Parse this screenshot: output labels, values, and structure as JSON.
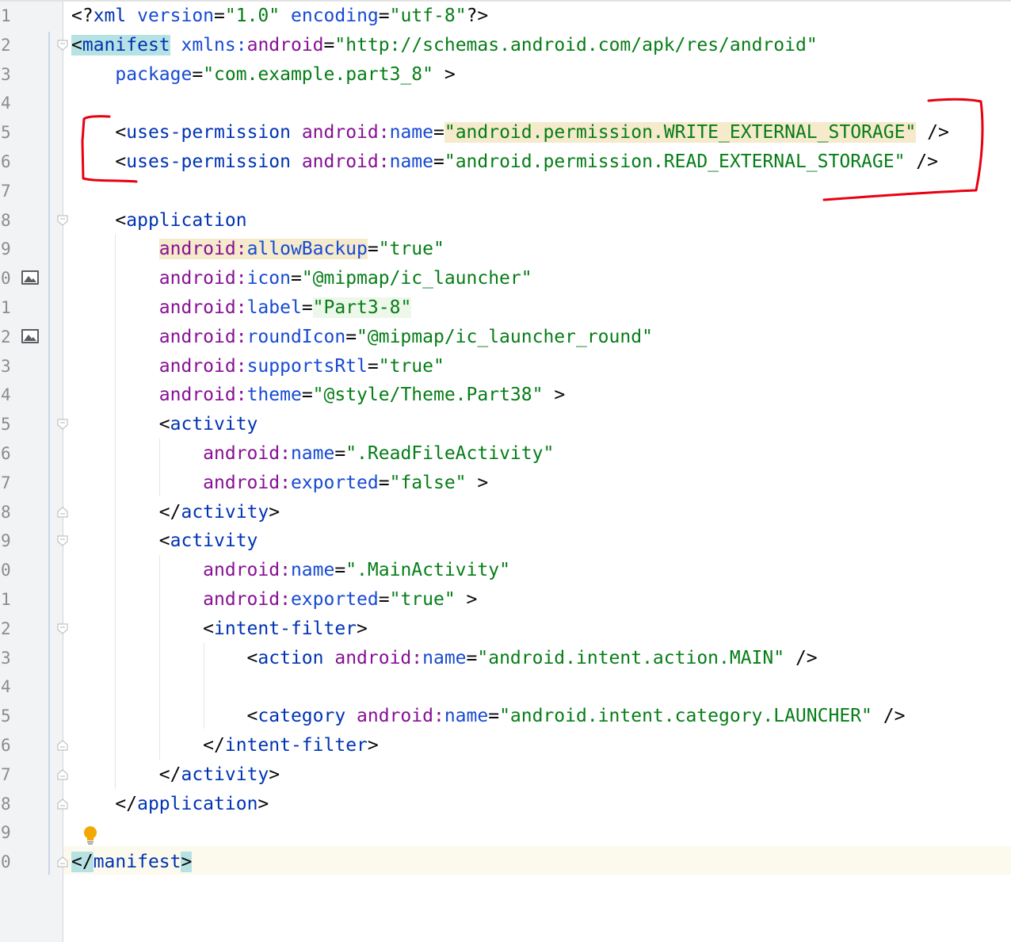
{
  "editor": {
    "line_numbers": [
      "1",
      "2",
      "3",
      "4",
      "5",
      "6",
      "7",
      "8",
      "9",
      "0",
      "1",
      "2",
      "3",
      "4",
      "5",
      "6",
      "7",
      "8",
      "9",
      "0",
      "1",
      "2",
      "3",
      "4",
      "5",
      "6",
      "7",
      "8",
      "9",
      "0"
    ],
    "lines": [
      {
        "segments": [
          {
            "t": "<?",
            "c": "punct"
          },
          {
            "t": "xml ",
            "c": "tag"
          },
          {
            "t": "version",
            "c": "attr"
          },
          {
            "t": "=",
            "c": "punct"
          },
          {
            "t": "\"1.0\"",
            "c": "val"
          },
          {
            "t": " ",
            "c": "punct"
          },
          {
            "t": "encoding",
            "c": "attr"
          },
          {
            "t": "=",
            "c": "punct"
          },
          {
            "t": "\"utf-8\"",
            "c": "val"
          },
          {
            "t": "?>",
            "c": "punct"
          }
        ]
      },
      {
        "segments": [
          {
            "t": "<",
            "c": "punct hl-teal"
          },
          {
            "t": "manifest",
            "c": "tag hl-teal"
          },
          {
            "t": " ",
            "c": "punct"
          },
          {
            "t": "xmlns:",
            "c": "attr"
          },
          {
            "t": "android",
            "c": "attr-ns"
          },
          {
            "t": "=",
            "c": "punct"
          },
          {
            "t": "\"http://schemas.android.com/apk/res/android\"",
            "c": "val"
          }
        ]
      },
      {
        "segments": [
          {
            "t": "    ",
            "c": "punct"
          },
          {
            "t": "package",
            "c": "attr"
          },
          {
            "t": "=",
            "c": "punct"
          },
          {
            "t": "\"com.example.part3_8\"",
            "c": "val"
          },
          {
            "t": " >",
            "c": "punct"
          }
        ]
      },
      {
        "segments": []
      },
      {
        "segments": [
          {
            "t": "    <",
            "c": "punct"
          },
          {
            "t": "uses-permission ",
            "c": "tag"
          },
          {
            "t": "android:",
            "c": "attr-ns"
          },
          {
            "t": "name",
            "c": "attr"
          },
          {
            "t": "=",
            "c": "punct"
          },
          {
            "t": "\"android.permission.WRITE_EXTERNAL_STORAGE\"",
            "c": "val hl-yellow"
          },
          {
            "t": " />",
            "c": "punct"
          }
        ]
      },
      {
        "segments": [
          {
            "t": "    <",
            "c": "punct"
          },
          {
            "t": "uses-permission ",
            "c": "tag"
          },
          {
            "t": "android:",
            "c": "attr-ns"
          },
          {
            "t": "name",
            "c": "attr"
          },
          {
            "t": "=",
            "c": "punct"
          },
          {
            "t": "\"android.permission.READ_EXTERNAL_STORAGE\"",
            "c": "val"
          },
          {
            "t": " />",
            "c": "punct"
          }
        ]
      },
      {
        "segments": []
      },
      {
        "segments": [
          {
            "t": "    <",
            "c": "punct"
          },
          {
            "t": "application",
            "c": "tag"
          }
        ]
      },
      {
        "segments": [
          {
            "t": "        ",
            "c": "punct"
          },
          {
            "t": "android:",
            "c": "attr-ns hl-yellow"
          },
          {
            "t": "allowBackup",
            "c": "attr hl-yellow"
          },
          {
            "t": "=",
            "c": "punct"
          },
          {
            "t": "\"true\"",
            "c": "val"
          }
        ]
      },
      {
        "segments": [
          {
            "t": "        ",
            "c": "punct"
          },
          {
            "t": "android:",
            "c": "attr-ns"
          },
          {
            "t": "icon",
            "c": "attr"
          },
          {
            "t": "=",
            "c": "punct"
          },
          {
            "t": "\"@mipmap/ic_launcher\"",
            "c": "val"
          }
        ]
      },
      {
        "segments": [
          {
            "t": "        ",
            "c": "punct"
          },
          {
            "t": "android:",
            "c": "attr-ns"
          },
          {
            "t": "label",
            "c": "attr"
          },
          {
            "t": "=",
            "c": "punct"
          },
          {
            "t": "\"Part3-8\"",
            "c": "val hl-green"
          }
        ]
      },
      {
        "segments": [
          {
            "t": "        ",
            "c": "punct"
          },
          {
            "t": "android:",
            "c": "attr-ns"
          },
          {
            "t": "roundIcon",
            "c": "attr"
          },
          {
            "t": "=",
            "c": "punct"
          },
          {
            "t": "\"@mipmap/ic_launcher_round\"",
            "c": "val"
          }
        ]
      },
      {
        "segments": [
          {
            "t": "        ",
            "c": "punct"
          },
          {
            "t": "android:",
            "c": "attr-ns"
          },
          {
            "t": "supportsRtl",
            "c": "attr"
          },
          {
            "t": "=",
            "c": "punct"
          },
          {
            "t": "\"true\"",
            "c": "val"
          }
        ]
      },
      {
        "segments": [
          {
            "t": "        ",
            "c": "punct"
          },
          {
            "t": "android:",
            "c": "attr-ns"
          },
          {
            "t": "theme",
            "c": "attr"
          },
          {
            "t": "=",
            "c": "punct"
          },
          {
            "t": "\"@style/Theme.Part38\"",
            "c": "val"
          },
          {
            "t": " >",
            "c": "punct"
          }
        ]
      },
      {
        "segments": [
          {
            "t": "        <",
            "c": "punct"
          },
          {
            "t": "activity",
            "c": "tag"
          }
        ]
      },
      {
        "segments": [
          {
            "t": "            ",
            "c": "punct"
          },
          {
            "t": "android:",
            "c": "attr-ns"
          },
          {
            "t": "name",
            "c": "attr"
          },
          {
            "t": "=",
            "c": "punct"
          },
          {
            "t": "\".ReadFileActivity\"",
            "c": "val"
          }
        ]
      },
      {
        "segments": [
          {
            "t": "            ",
            "c": "punct"
          },
          {
            "t": "android:",
            "c": "attr-ns"
          },
          {
            "t": "exported",
            "c": "attr"
          },
          {
            "t": "=",
            "c": "punct"
          },
          {
            "t": "\"false\"",
            "c": "val"
          },
          {
            "t": " >",
            "c": "punct"
          }
        ]
      },
      {
        "segments": [
          {
            "t": "        </",
            "c": "punct"
          },
          {
            "t": "activity",
            "c": "tag"
          },
          {
            "t": ">",
            "c": "punct"
          }
        ]
      },
      {
        "segments": [
          {
            "t": "        <",
            "c": "punct"
          },
          {
            "t": "activity",
            "c": "tag"
          }
        ]
      },
      {
        "segments": [
          {
            "t": "            ",
            "c": "punct"
          },
          {
            "t": "android:",
            "c": "attr-ns"
          },
          {
            "t": "name",
            "c": "attr"
          },
          {
            "t": "=",
            "c": "punct"
          },
          {
            "t": "\".MainActivity\"",
            "c": "val"
          }
        ]
      },
      {
        "segments": [
          {
            "t": "            ",
            "c": "punct"
          },
          {
            "t": "android:",
            "c": "attr-ns"
          },
          {
            "t": "exported",
            "c": "attr"
          },
          {
            "t": "=",
            "c": "punct"
          },
          {
            "t": "\"true\"",
            "c": "val"
          },
          {
            "t": " >",
            "c": "punct"
          }
        ]
      },
      {
        "segments": [
          {
            "t": "            <",
            "c": "punct"
          },
          {
            "t": "intent-filter",
            "c": "tag"
          },
          {
            "t": ">",
            "c": "punct"
          }
        ]
      },
      {
        "segments": [
          {
            "t": "                <",
            "c": "punct"
          },
          {
            "t": "action ",
            "c": "tag"
          },
          {
            "t": "android:",
            "c": "attr-ns"
          },
          {
            "t": "name",
            "c": "attr"
          },
          {
            "t": "=",
            "c": "punct"
          },
          {
            "t": "\"android.intent.action.MAIN\"",
            "c": "val"
          },
          {
            "t": " />",
            "c": "punct"
          }
        ]
      },
      {
        "segments": []
      },
      {
        "segments": [
          {
            "t": "                <",
            "c": "punct"
          },
          {
            "t": "category ",
            "c": "tag"
          },
          {
            "t": "android:",
            "c": "attr-ns"
          },
          {
            "t": "name",
            "c": "attr"
          },
          {
            "t": "=",
            "c": "punct"
          },
          {
            "t": "\"android.intent.category.LAUNCHER\"",
            "c": "val"
          },
          {
            "t": " />",
            "c": "punct"
          }
        ]
      },
      {
        "segments": [
          {
            "t": "            </",
            "c": "punct"
          },
          {
            "t": "intent-filter",
            "c": "tag"
          },
          {
            "t": ">",
            "c": "punct"
          }
        ]
      },
      {
        "segments": [
          {
            "t": "        </",
            "c": "punct"
          },
          {
            "t": "activity",
            "c": "tag"
          },
          {
            "t": ">",
            "c": "punct"
          }
        ]
      },
      {
        "segments": [
          {
            "t": "    </",
            "c": "punct"
          },
          {
            "t": "application",
            "c": "tag"
          },
          {
            "t": ">",
            "c": "punct"
          }
        ]
      },
      {
        "segments": []
      },
      {
        "segments": [
          {
            "t": "</",
            "c": "punct hl-teal"
          },
          {
            "t": "manifest",
            "c": "tag"
          },
          {
            "t": ">",
            "c": "punct hl-teal"
          }
        ]
      }
    ]
  },
  "colors": {
    "tag": "#0033b3",
    "attribute_namespace": "#871094",
    "attribute": "#174ad4",
    "value": "#067d17",
    "annotation": "#e8000f",
    "gutter": "#f2f3f5",
    "current_line": "#fcfaed"
  },
  "icons": {
    "image_preview": "image-icon",
    "fold": "fold-marker-icon",
    "intention": "lightbulb-icon"
  }
}
